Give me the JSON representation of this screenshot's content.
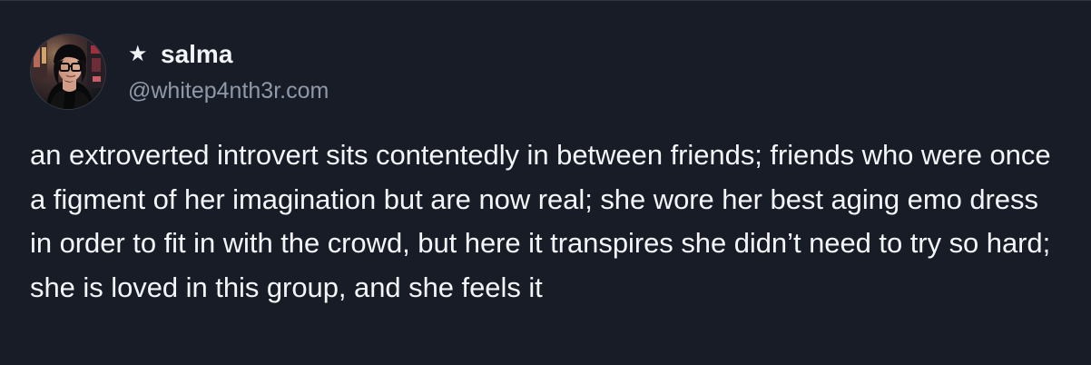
{
  "post": {
    "author": {
      "star_icon": "★",
      "name": "salma",
      "handle": "@whitep4nth3r.com",
      "avatar": "avatar"
    },
    "text": "an extroverted introvert sits contentedly in between friends; friends who were once a figment of her imagination but are now real; she wore her best aging emo dress in order to fit in with the crowd, but here it transpires she didn’t need to try so hard; she is loved in this group, and she feels it"
  },
  "colors": {
    "background": "#171c26",
    "primary_text": "#f3f5f8",
    "secondary_text": "#8f99aa"
  }
}
